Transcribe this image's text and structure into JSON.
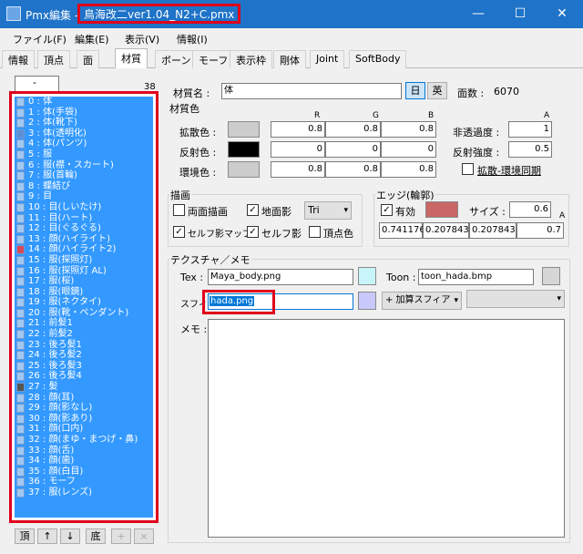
{
  "window": {
    "title_app": "Pmx編集 - ",
    "title_file": "鳥海改二ver1.04_N2+C.pmx",
    "minimize": "—",
    "maximize": "☐",
    "close": "✕"
  },
  "menu": [
    "ファイル(F)",
    "編集(E)",
    "表示(V)",
    "情報(I)"
  ],
  "tabs": [
    "情報",
    "頂点",
    "面",
    "材質",
    "ボーン",
    "モーフ",
    "表示枠",
    "剛体",
    "Joint",
    "SoftBody"
  ],
  "left": {
    "combo_value": "-",
    "count": "38",
    "items": [
      "0 : 体",
      "1 : 体(手袋)",
      "2 : 体(靴下)",
      "3 : 体(透明化)",
      "4 : 体(パンツ)",
      "5 : 服",
      "6 : 服(襟・スカート)",
      "7 : 服(首輪)",
      "8 : 蝶結び",
      "9 : 目",
      "10 : 目(しいたけ)",
      "11 : 目(ハート)",
      "12 : 目(ぐるぐる)",
      "13 : 顔(ハイライト)",
      "14 : 顔(ハイライト2)",
      "15 : 服(探照灯)",
      "16 : 服(探照灯 AL)",
      "17 : 服(桜)",
      "18 : 服(眼鏡)",
      "19 : 服(ネクタイ)",
      "20 : 服(靴・ペンダント)",
      "21 : 前髪1",
      "22 : 前髪2",
      "23 : 後ろ髪1",
      "24 : 後ろ髪2",
      "25 : 後ろ髪3",
      "26 : 後ろ髪4",
      "27 : 髪",
      "28 : 顔(耳)",
      "29 : 顔(影なし)",
      "30 : 顔(影あり)",
      "31 : 顔(口内)",
      "32 : 顔(まゆ・まつげ・鼻)",
      "33 : 顔(舌)",
      "34 : 顔(歯)",
      "35 : 顔(白目)",
      "36 : モーフ",
      "37 : 服(レンズ)"
    ],
    "swatch_colors": {
      "3": "#5b8fd6",
      "14": "#d64a57",
      "27": "#555555"
    },
    "buttons": [
      "頂",
      "↑",
      "↓",
      "底",
      "+",
      "×"
    ]
  },
  "material": {
    "name_label": "材質名 :",
    "name_value": "体",
    "lang_ja": "日",
    "lang_en": "英",
    "face_count_label": "面数 :",
    "face_count": "6070",
    "color_section": "材質色",
    "col_r": "R",
    "col_g": "G",
    "col_b": "B",
    "col_a": "A",
    "diffuse_label": "拡散色 :",
    "diffuse": [
      "0.8",
      "0.8",
      "0.8"
    ],
    "specular_label": "反射色 :",
    "specular": [
      "0",
      "0",
      "0"
    ],
    "ambient_label": "環境色 :",
    "ambient": [
      "0.8",
      "0.8",
      "0.8"
    ],
    "alpha_label": "非透過度 :",
    "alpha": "1",
    "spec_power_label": "反射強度 :",
    "spec_power": "0.5",
    "sync_label": "拡散-環境同期",
    "draw_section": "描画",
    "double_sided": "両面描画",
    "ground_shadow": "地面影",
    "tri_value": "Tri",
    "self_shadow_map": "セルフ影マップ",
    "self_shadow": "セルフ影",
    "vertex_color": "頂点色",
    "edge_section": "エッジ(輪郭)",
    "edge_enabled": "有効",
    "edge_size_label": "サイズ :",
    "edge_size": "0.6",
    "edge_color": [
      "0.741176",
      "0.207843",
      "0.207843",
      "0.7"
    ],
    "edge_a": "A",
    "tex_section": "テクスチャ／メモ",
    "tex_label": "Tex :",
    "tex_value": "Maya_body.png",
    "toon_label": "Toon :",
    "toon_value": "toon_hada.bmp",
    "sphere_label": "スフィア",
    "sphere_value": "hada.png",
    "sphere_mode": "+ 加算スフィア",
    "memo_label": "メモ :"
  }
}
